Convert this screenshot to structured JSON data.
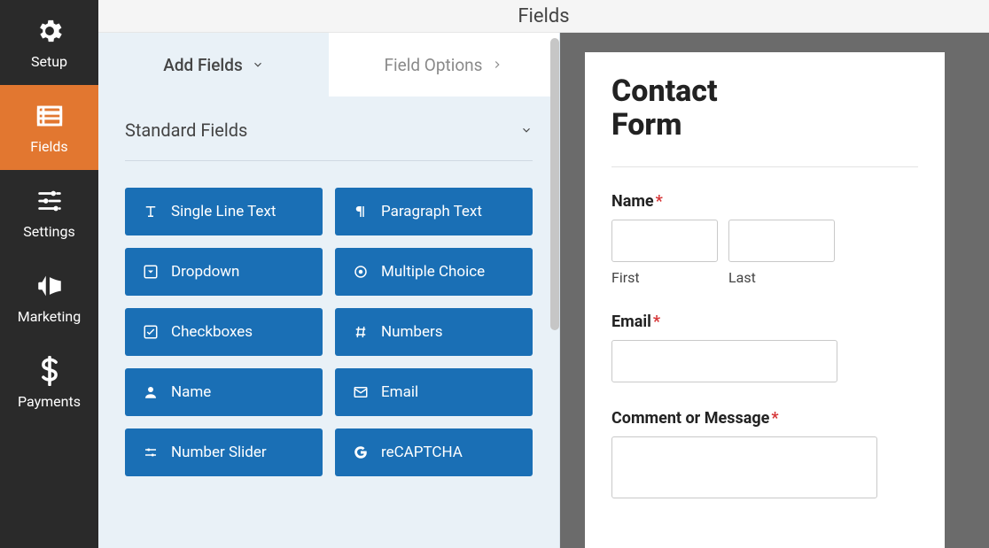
{
  "header": {
    "title": "Fields"
  },
  "nav": {
    "items": [
      {
        "label": "Setup"
      },
      {
        "label": "Fields"
      },
      {
        "label": "Settings"
      },
      {
        "label": "Marketing"
      },
      {
        "label": "Payments"
      }
    ]
  },
  "tabs": {
    "add": "Add Fields",
    "options": "Field Options"
  },
  "section": {
    "title": "Standard Fields"
  },
  "fields": {
    "single_line": "Single Line Text",
    "paragraph": "Paragraph Text",
    "dropdown": "Dropdown",
    "multiple": "Multiple Choice",
    "checkboxes": "Checkboxes",
    "numbers": "Numbers",
    "name": "Name",
    "email": "Email",
    "slider": "Number Slider",
    "recaptcha": "reCAPTCHA"
  },
  "preview": {
    "form_title_line1": "Contact",
    "form_title_line2": "Form",
    "name_label": "Name",
    "first_sub": "First",
    "last_sub": "Last",
    "email_label": "Email",
    "comment_label": "Comment or Message",
    "asterisk": "*"
  }
}
